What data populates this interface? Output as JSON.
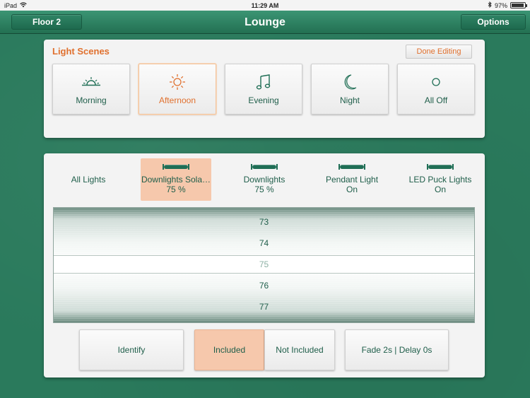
{
  "status_bar": {
    "device": "iPad",
    "time": "11:29 AM",
    "battery": "97%",
    "battery_level": 0.97
  },
  "nav": {
    "left_button": "Floor 2",
    "title": "Lounge",
    "right_button": "Options"
  },
  "scenes": {
    "title": "Light Scenes",
    "done_button": "Done Editing",
    "items": [
      {
        "label": "Morning",
        "icon": "sunrise-icon",
        "active": false
      },
      {
        "label": "Afternoon",
        "icon": "sun-icon",
        "active": true
      },
      {
        "label": "Evening",
        "icon": "music-note-icon",
        "active": false
      },
      {
        "label": "Night",
        "icon": "moon-icon",
        "active": false
      },
      {
        "label": "All Off",
        "icon": "circle-icon",
        "active": false
      }
    ]
  },
  "lights": {
    "tabs": [
      {
        "name": "All Lights",
        "value": ""
      },
      {
        "name": "Downlights Sola…",
        "value": "75 %"
      },
      {
        "name": "Downlights",
        "value": "75 %"
      },
      {
        "name": "Pendant Light",
        "value": "On"
      },
      {
        "name": "LED Puck Lights",
        "value": "On"
      }
    ],
    "picker": [
      "73",
      "74",
      "75",
      "76",
      "77"
    ],
    "picker_selected": "75",
    "buttons": {
      "identify": "Identify",
      "included": "Included",
      "not_included": "Not Included",
      "fade": "Fade 2s | Delay 0s"
    }
  },
  "colors": {
    "accent": "#e0702e",
    "primary_text": "#1f5e4a",
    "background": "#2a7a5c",
    "selected_fill": "#f6c8ac"
  }
}
